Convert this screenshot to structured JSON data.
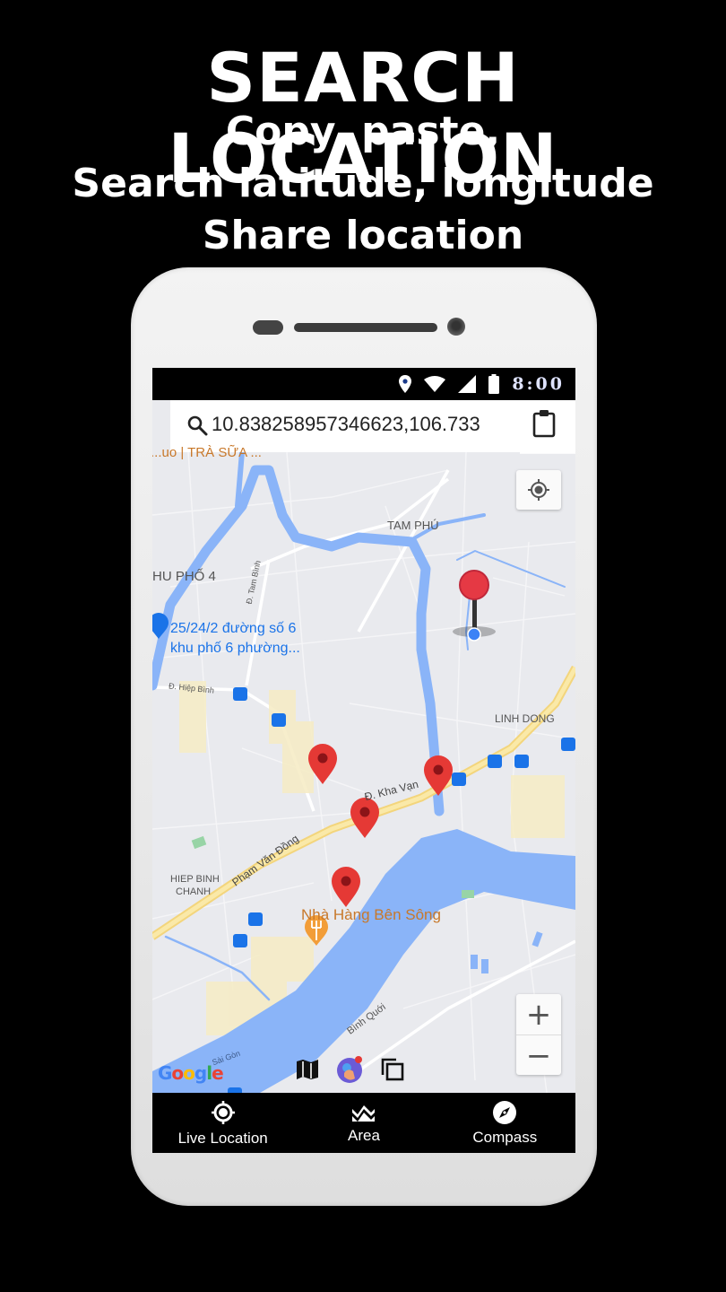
{
  "promo": {
    "title": "SEARCH LOCATION",
    "line1": "Copy, paste,",
    "line2": "Search latitude, longitude",
    "line3": "Share location"
  },
  "statusbar": {
    "time": "8:00",
    "icons": [
      "location-icon",
      "wifi-icon",
      "signal-icon",
      "battery-icon"
    ]
  },
  "search": {
    "value": "10.838258957346623,106.733",
    "icon": "search-icon",
    "paste_icon": "clipboard-icon"
  },
  "map": {
    "top_label": "...uo | TRÀ SỮA ...",
    "labels": {
      "tam_phu": "TAM PHÚ",
      "khu_pho_4": "HU PHỐ 4",
      "address_line1": "25/24/2 đường số 6",
      "address_line2": "khu phố 6 phường...",
      "hiep_binh_road": "Đ. Hiệp Bình",
      "tam_binh_road": "Đ. Tam Bình",
      "linh_dong": "LINH DONG",
      "kha_van_road": "Đ. Kha Vạn",
      "pham_van_dong": "Phạm Văn Đồng",
      "hiep_binh_chanh_1": "HIEP BINH",
      "hiep_binh_chanh_2": "CHANH",
      "restaurant": "Nhà Hàng Bên Sông",
      "binh_quoi": "Bình Quới",
      "saigon": "Sài Gòn"
    },
    "google_logo": "Google",
    "zoom_in": "+",
    "zoom_out": "−",
    "colors": {
      "land": "#e9eaee",
      "water": "#8ab4f8",
      "highway": "#f8dc8a",
      "marker": "#e53935",
      "poi_label": "#c8782a",
      "address_label": "#1a73e8"
    }
  },
  "bottom_nav": [
    {
      "label": "Live Location",
      "icon": "crosshair-icon"
    },
    {
      "label": "Area",
      "icon": "area-icon"
    },
    {
      "label": "Compass",
      "icon": "compass-icon"
    }
  ]
}
